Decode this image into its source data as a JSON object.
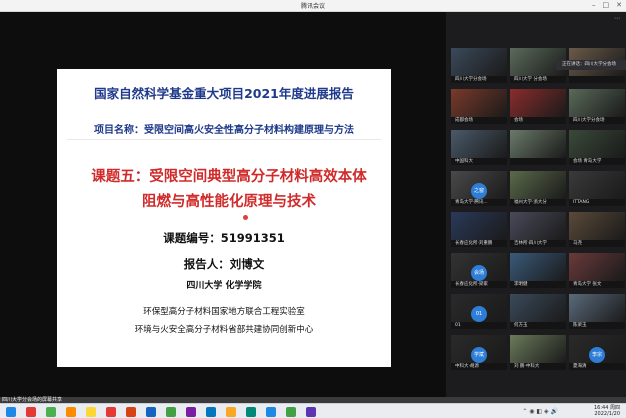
{
  "window": {
    "title": "腾讯会议",
    "controls": [
      "–",
      "□",
      "✕"
    ]
  },
  "slide": {
    "title": "国家自然科学基金重大项目2021年度进展报告",
    "project": "项目名称：受限空间高火安全性高分子材料构建原理与方法",
    "topic_line1": "课题五：受限空间典型高分子材料高效本体",
    "topic_line2": "阻燃与高性能化原理与技术",
    "number": "课题编号：51991351",
    "reporter": "报告人：刘博文",
    "affiliation": "四川大学 化学学院",
    "lab1": "环保型高分子材料国家地方联合工程实验室",
    "lab2": "环境与火安全高分子材料省部共建协同创新中心"
  },
  "participants": {
    "overlay_label": "正在讲话：四川大学分会场",
    "tiles": [
      {
        "name": "四川大学分会场",
        "color": "#3b4a5a"
      },
      {
        "name": "四川大学 分会场",
        "color": "#5b6b5a"
      },
      {
        "name": "",
        "color": "#6a5a4a"
      },
      {
        "name": "成都会场",
        "color": "#7a3a2a"
      },
      {
        "name": "会场",
        "color": "#8b2c2c"
      },
      {
        "name": "四川大学分会场",
        "color": "#5a6a5a"
      },
      {
        "name": "中国科大",
        "color": "#4a5a6a"
      },
      {
        "name": "",
        "color": "#6a7a6a"
      },
      {
        "name": "会场 青岛大学",
        "color": "#3a4a3a"
      },
      {
        "name": "青岛大学·腾讯...",
        "color": "#4a4a4a",
        "avatar": "之窗",
        "avatar_color": "#2e7dd7"
      },
      {
        "name": "福州大学·浙大分",
        "color": "#5a6a4a"
      },
      {
        "name": "ITTANG",
        "color": "#3a3a3a"
      },
      {
        "name": "长春应化所·刘重鹏",
        "color": "#2a3a5a"
      },
      {
        "name": "吉林所·四川大学",
        "color": "#4a4a5a"
      },
      {
        "name": "马尧",
        "color": "#5a4a3a"
      },
      {
        "name": "长春应化所·梁家",
        "color": "#333333",
        "avatar": "会场",
        "avatar_color": "#2e7dd7"
      },
      {
        "name": "李明健",
        "color": "#3a5a7a"
      },
      {
        "name": "青岛大学 张文",
        "color": "#6a3a3a"
      },
      {
        "name": "01",
        "color": "#2a2a2a",
        "avatar": "01",
        "avatar_color": "#2e7dd7"
      },
      {
        "name": "何方玉",
        "color": "#3a4a5a"
      },
      {
        "name": "陈梁玉",
        "color": "#5a6a7a"
      },
      {
        "name": "中科大·胡源",
        "color": "#2a2a2a",
        "avatar": "学斌",
        "avatar_color": "#2e7dd7"
      },
      {
        "name": "刘 鹏·中科大",
        "color": "#6a7a5a"
      },
      {
        "name": "夏海清",
        "color": "#2a2a2a",
        "avatar": "李宗",
        "avatar_color": "#2e7dd7"
      }
    ]
  },
  "share_bar": {
    "label": "四川大学分会场的屏幕共享"
  },
  "taskbar": {
    "icons": [
      {
        "name": "start-icon",
        "color": "#1e88e5"
      },
      {
        "name": "browser-icon",
        "color": "#e53935"
      },
      {
        "name": "meeting-icon",
        "color": "#4caf50"
      },
      {
        "name": "app-icon",
        "color": "#fb8c00"
      },
      {
        "name": "folder-icon",
        "color": "#fdd835"
      },
      {
        "name": "pdf-icon",
        "color": "#e53935"
      },
      {
        "name": "ppt-icon",
        "color": "#d84315"
      },
      {
        "name": "app-icon-2",
        "color": "#1565c0"
      },
      {
        "name": "chrome-icon",
        "color": "#43a047"
      },
      {
        "name": "app-icon-3",
        "color": "#7b1fa2"
      },
      {
        "name": "app-icon-4",
        "color": "#0277bd"
      },
      {
        "name": "app-icon-5",
        "color": "#f9a825"
      },
      {
        "name": "app-icon-6",
        "color": "#00897b"
      },
      {
        "name": "app-icon-7",
        "color": "#1e88e5"
      },
      {
        "name": "wechat-icon",
        "color": "#43a047"
      },
      {
        "name": "app-icon-8",
        "color": "#5e35b1"
      }
    ],
    "time": "16:44 周四",
    "date": "2022/1/20"
  }
}
